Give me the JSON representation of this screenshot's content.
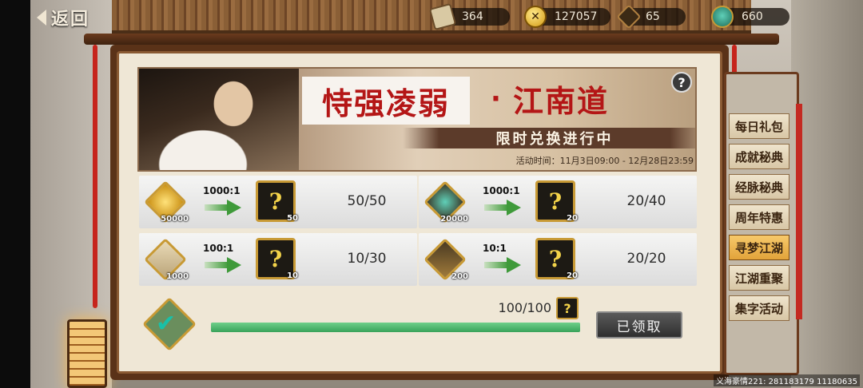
{
  "topbar": {
    "back_label": "返回",
    "resources": [
      {
        "icon": "scroll-icon",
        "value": "364"
      },
      {
        "icon": "gold-coin-icon",
        "value": "127057"
      },
      {
        "icon": "token-icon",
        "value": "65"
      },
      {
        "icon": "jade-icon",
        "value": "660"
      }
    ]
  },
  "banner": {
    "title": "恃强凌弱",
    "title_dot": "·",
    "subtitle": "江南道",
    "ribbon": "限时兑换进行中",
    "event_time": "活动时间：11月3日09:00 - 12月28日23:59",
    "help": "?"
  },
  "exchanges": [
    {
      "source_icon": "gold-coin-icon",
      "source_count": "50000",
      "ratio": "1000:1",
      "result_count": "50",
      "progress": "50/50"
    },
    {
      "source_icon": "jade-icon",
      "source_count": "20000",
      "ratio": "1000:1",
      "result_count": "20",
      "progress": "20/40"
    },
    {
      "source_icon": "scroll-icon",
      "source_count": "1000",
      "ratio": "100:1",
      "result_count": "10",
      "progress": "10/30"
    },
    {
      "source_icon": "token-icon",
      "source_count": "200",
      "ratio": "10:1",
      "result_count": "20",
      "progress": "20/20"
    }
  ],
  "mystery_mark": "?",
  "bottom": {
    "progress_text": "100/100",
    "progress_fraction": 1.0,
    "claim_label": "已领取"
  },
  "side_tabs": [
    {
      "label": "每日礼包",
      "active": false
    },
    {
      "label": "成就秘典",
      "active": false
    },
    {
      "label": "经脉秘典",
      "active": false
    },
    {
      "label": "周年特惠",
      "active": false
    },
    {
      "label": "寻梦江湖",
      "active": true
    },
    {
      "label": "江湖重聚",
      "active": false
    },
    {
      "label": "集字活动",
      "active": false
    }
  ],
  "footer": {
    "id_text": "义海豪情221: 281183179 11180635"
  },
  "colors": {
    "accent_red": "#b41616",
    "progress_green": "#38a25a",
    "tab_active": "#e2a33a"
  }
}
